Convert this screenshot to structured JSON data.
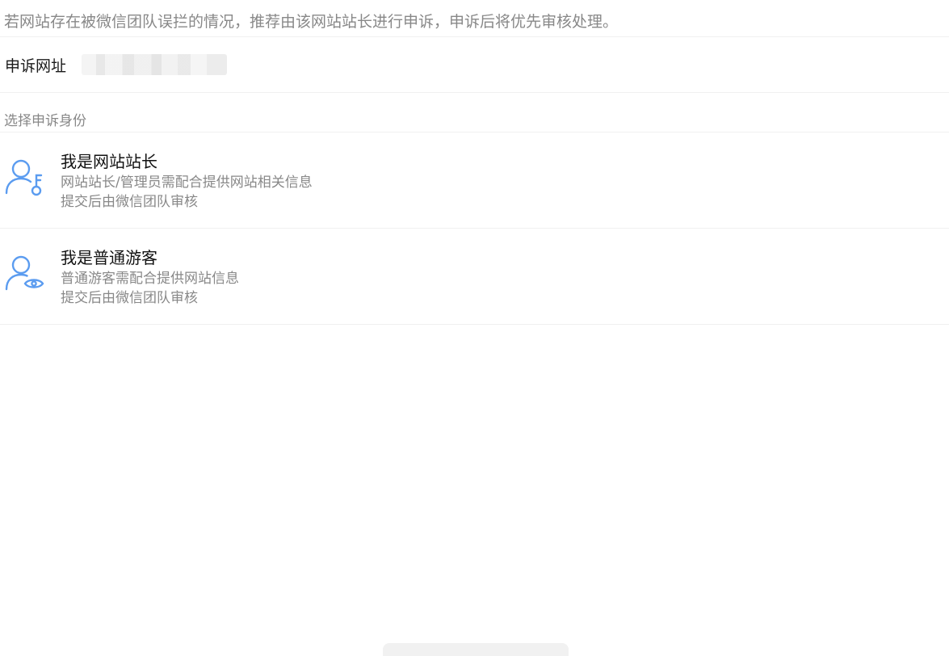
{
  "notice": "若网站存在被微信团队误拦的情况，推荐由该网站站长进行申诉，申诉后将优先审核处理。",
  "url_row": {
    "label": "申诉网址"
  },
  "identity_section": {
    "label": "选择申诉身份"
  },
  "options": [
    {
      "title": "我是网站站长",
      "desc_line1": "网站站长/管理员需配合提供网站相关信息",
      "desc_line2": "提交后由微信团队审核",
      "icon": "user-key-icon"
    },
    {
      "title": "我是普通游客",
      "desc_line1": "普通游客需配合提供网站信息",
      "desc_line2": "提交后由微信团队审核",
      "icon": "user-eye-icon"
    }
  ],
  "colors": {
    "accent": "#5b9cf0",
    "text_primary": "#111111",
    "text_secondary": "#888888",
    "divider": "#f0f0f0"
  }
}
